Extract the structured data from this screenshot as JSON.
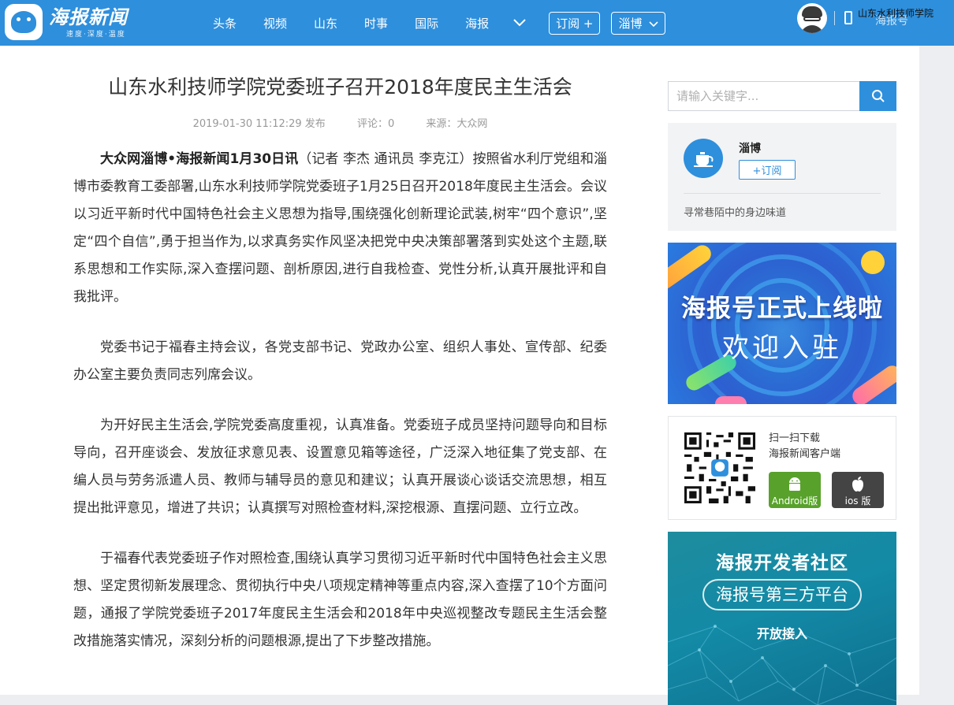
{
  "header": {
    "logo_name": "海报新闻",
    "logo_slogan": "速度·深度·温度",
    "nav": [
      "头条",
      "视频",
      "山东",
      "时事",
      "国际",
      "海报"
    ],
    "subscribe_label": "订阅 +",
    "city_label": "淄博",
    "user_name": "山东水利技师学院",
    "app_link": "海报号"
  },
  "article": {
    "title": "山东水利技师学院党委班子召开2018年度民主生活会",
    "meta": {
      "time": "2019-01-30 11:12:29 发布",
      "comments": "评论：0",
      "source": "来源：大众网"
    },
    "lead": "大众网淄博•海报新闻1月30日讯",
    "paragraphs": [
      "（记者 李杰 通讯员 李克江）按照省水利厅党组和淄博市委教育工委部署,山东水利技师学院党委班子1月25日召开2018年度民主生活会。会议以习近平新时代中国特色社会主义思想为指导,围绕强化创新理论武装,树牢“四个意识”,坚定“四个自信”,勇于担当作为,以求真务实作风坚决把党中央决策部署落到实处这个主题,联系思想和工作实际,深入查摆问题、剖析原因,进行自我检查、党性分析,认真开展批评和自我批评。",
      "党委书记于福春主持会议，各党支部书记、党政办公室、组织人事处、宣传部、纪委办公室主要负责同志列席会议。",
      "为开好民主生活会,学院党委高度重视，认真准备。党委班子成员坚持问题导向和目标导向，召开座谈会、发放征求意见表、设置意见箱等途径，广泛深入地征集了党支部、在编人员与劳务派遣人员、教师与辅导员的意见和建议；认真开展谈心谈话交流思想，相互提出批评意见，增进了共识；认真撰写对照检查材料,深挖根源、直摆问题、立行立改。",
      "于福春代表党委班子作对照检查,围绕认真学习贯彻习近平新时代中国特色社会主义思想、坚定贯彻新发展理念、贯彻执行中央八项规定精神等重点内容,深入查摆了10个方面问题，通报了学院党委班子2017年度民主生活会和2018年中央巡视整改专题民主生活会整改措施落实情况，深刻分析的问题根源,提出了下步整改措施。"
    ]
  },
  "sidebar": {
    "search_placeholder": "请输入关键字...",
    "account": {
      "name": "淄博",
      "subscribe": "+订阅",
      "desc": "寻常巷陌中的身边味道"
    },
    "banner1": {
      "line1": "海报号正式上线啦",
      "line2": "欢迎入驻"
    },
    "download": {
      "line1": "扫一扫下载",
      "line2": "海报新闻客户端",
      "android": "Android版",
      "ios": "ios 版"
    },
    "banner2": {
      "line1": "海报开发者社区",
      "line2": "海报号第三方平台",
      "line3": "开放接入"
    }
  },
  "colors": {
    "brand_blue": "#2e8fdc",
    "android_green": "#58a22b",
    "ios_dark": "#444444"
  }
}
